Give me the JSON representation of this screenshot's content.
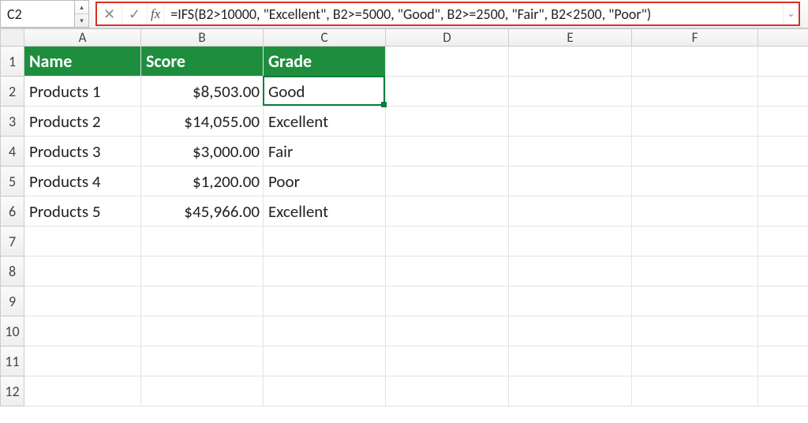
{
  "formula_bar": {
    "cell_ref": "C2",
    "fx_label": "fx",
    "formula": "=IFS(B2>10000, \"Excellent\", B2>=5000, \"Good\", B2>=2500, \"Fair\", B2<2500, \"Poor\")",
    "cancel_glyph": "✕",
    "enter_glyph": "✓",
    "up_glyph": "▴",
    "down_glyph": "▾",
    "expand_glyph": "⌄"
  },
  "columns": [
    "A",
    "B",
    "C",
    "D",
    "E",
    "F",
    ""
  ],
  "row_numbers": [
    "1",
    "2",
    "3",
    "4",
    "5",
    "6",
    "7",
    "8",
    "9",
    "10",
    "11",
    "12"
  ],
  "header_row": {
    "A": "Name",
    "B": "Score",
    "C": "Grade"
  },
  "data_rows": [
    {
      "A": "Products 1",
      "B": "$8,503.00",
      "C": "Good"
    },
    {
      "A": "Products 2",
      "B": "$14,055.00",
      "C": "Excellent"
    },
    {
      "A": "Products 3",
      "B": "$3,000.00",
      "C": "Fair"
    },
    {
      "A": "Products 4",
      "B": "$1,200.00",
      "C": "Poor"
    },
    {
      "A": "Products 5",
      "B": "$45,966.00",
      "C": "Excellent"
    }
  ],
  "selected_cell": "C2",
  "colors": {
    "header_green": "#1e8e3e",
    "highlight_red": "#d93025",
    "sel_green": "#0a7d3a"
  }
}
